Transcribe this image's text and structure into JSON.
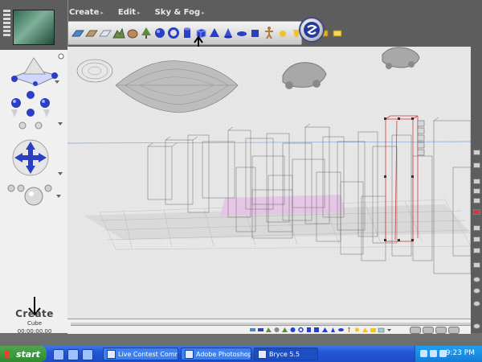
{
  "menu": {
    "items": [
      "Create",
      "Edit",
      "Sky & Fog"
    ]
  },
  "left_panel": {
    "create_title": "Create",
    "create_subtitle": "Cube",
    "create_time": "00:00:00.00"
  },
  "taskbar": {
    "start_label": "start",
    "windows": [
      "Live Contest Commen...",
      "Adobe Photoshop",
      "Bryce 5.5"
    ],
    "clock": "9:23 PM"
  },
  "colors": {
    "accent_blue": "#2436b8",
    "wireframe": "#6a6a6a",
    "selected_red": "#d23a3a",
    "ground_pink": "#d8a8d8",
    "taskbar_blue": "#2456d6"
  }
}
